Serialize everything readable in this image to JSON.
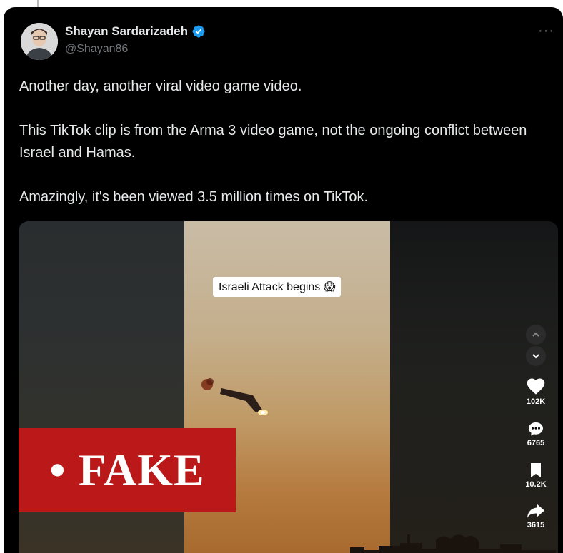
{
  "tweet": {
    "author_name": "Shayan Sardarizadeh",
    "author_handle": "@Shayan86",
    "more_label": "···",
    "paragraphs": [
      "Another day, another viral video game video.",
      "This TikTok clip is from the Arma 3 video game, not the ongoing conflict between Israel and Hamas.",
      "Amazingly, it's been viewed 3.5 million times on TikTok."
    ]
  },
  "media": {
    "caption": "Israeli Attack begins 😱",
    "fake_label": "• FAKE",
    "stats": {
      "likes": "102K",
      "comments": "6765",
      "saves": "10.2K",
      "shares": "3615"
    }
  },
  "icons": {
    "verified": "verified-badge-icon",
    "heart": "heart-icon",
    "comment": "comment-icon",
    "bookmark": "bookmark-icon",
    "share": "share-icon",
    "up": "chevron-up-icon",
    "down": "chevron-down-icon"
  },
  "colors": {
    "background": "#000000",
    "text": "#e7e9ea",
    "muted": "#71767b",
    "verified": "#1d9bf0",
    "fake_red": "#bb1919"
  }
}
